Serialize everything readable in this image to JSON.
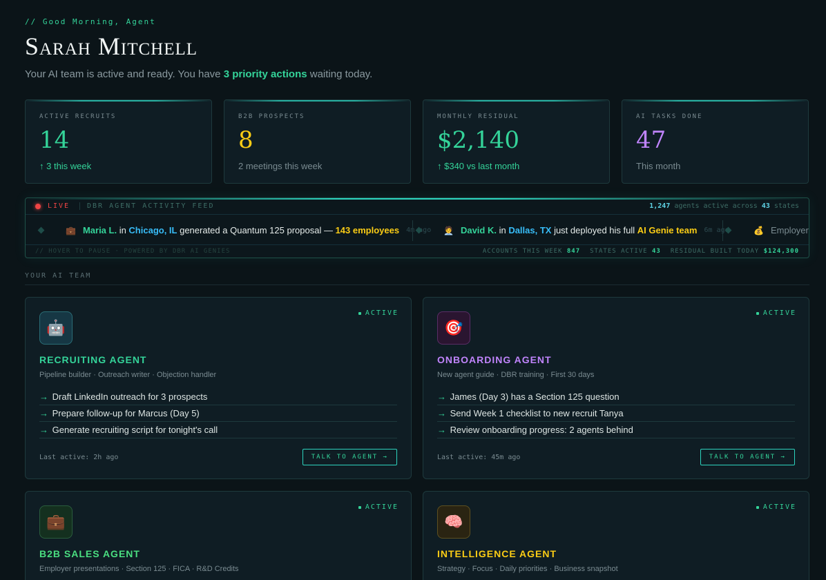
{
  "header": {
    "greeting": "// Good Morning, Agent",
    "name": "Sarah Mitchell",
    "subtitle_prefix": "Your AI team is active and ready. You have ",
    "subtitle_highlight": "3 priority actions",
    "subtitle_suffix": " waiting today."
  },
  "stats": [
    {
      "label": "ACTIVE RECRUITS",
      "value": "14",
      "sub": "↑ 3 this week",
      "value_color": "#34d399",
      "sub_color": "#34d399"
    },
    {
      "label": "B2B PROSPECTS",
      "value": "8",
      "sub": "2 meetings this week",
      "value_color": "#facc15",
      "sub_color": "#7a8b91"
    },
    {
      "label": "MONTHLY RESIDUAL",
      "value": "$2,140",
      "sub": "↑ $340 vs last month",
      "value_color": "#34d399",
      "sub_color": "#34d399"
    },
    {
      "label": "AI TASKS DONE",
      "value": "47",
      "sub": "This month",
      "value_color": "#c084fc",
      "sub_color": "#7a8b91"
    }
  ],
  "feed": {
    "live": "LIVE",
    "title": "DBR AGENT ACTIVITY FEED",
    "agents_active": "1,247",
    "agents_text": " agents active across ",
    "states": "43",
    "states_text": " states",
    "items": [
      {
        "icon": "💼",
        "who": "Maria L.",
        "in": " in ",
        "where": "Chicago, IL",
        "text": " generated a Quantum 125 proposal — ",
        "gold": "143 employees",
        "time": "4m ago"
      },
      {
        "icon": "🧑‍💼",
        "who": "David K.",
        "in": " in ",
        "where": "Dallas, TX",
        "text": " just deployed his full ",
        "gold": "AI Genie team",
        "time": "6m ago"
      },
      {
        "icon": "💰",
        "text": "Employer"
      }
    ],
    "footer_left": "// HOVER TO PAUSE · POWERED BY DBR AI GENIES",
    "accounts_label": "ACCOUNTS THIS WEEK ",
    "accounts_value": "847",
    "states_label": "STATES ACTIVE ",
    "states_value": "43",
    "residual_label": "RESIDUAL BUILT TODAY ",
    "residual_value": "$124,300"
  },
  "team_section_label": "YOUR AI TEAM",
  "agents": [
    {
      "icon": "robot-icon",
      "emoji": "🤖",
      "status": "ACTIVE",
      "title": "RECRUITING AGENT",
      "title_color": "#34d399",
      "desc": "Pipeline builder · Outreach writer · Objection handler",
      "tasks": [
        "Draft LinkedIn outreach for 3 prospects",
        "Prepare follow-up for Marcus (Day 5)",
        "Generate recruiting script for tonight's call"
      ],
      "last_active": "Last active: 2h ago",
      "button": "TALK TO AGENT →"
    },
    {
      "icon": "target-icon",
      "emoji": "🎯",
      "status": "ACTIVE",
      "title": "ONBOARDING AGENT",
      "title_color": "#c084fc",
      "desc": "New agent guide · DBR training · First 30 days",
      "tasks": [
        "James (Day 3) has a Section 125 question",
        "Send Week 1 checklist to new recruit Tanya",
        "Review onboarding progress: 2 agents behind"
      ],
      "last_active": "Last active: 45m ago",
      "button": "TALK TO AGENT →"
    },
    {
      "icon": "briefcase-icon",
      "emoji": "💼",
      "status": "ACTIVE",
      "title": "B2B SALES AGENT",
      "title_color": "#4ade80",
      "desc": "Employer presentations · Section 125 · FICA · R&D Credits"
    },
    {
      "icon": "brain-icon",
      "emoji": "🧠",
      "status": "ACTIVE",
      "title": "INTELLIGENCE AGENT",
      "title_color": "#facc15",
      "desc": "Strategy · Focus · Daily priorities · Business snapshot"
    }
  ]
}
